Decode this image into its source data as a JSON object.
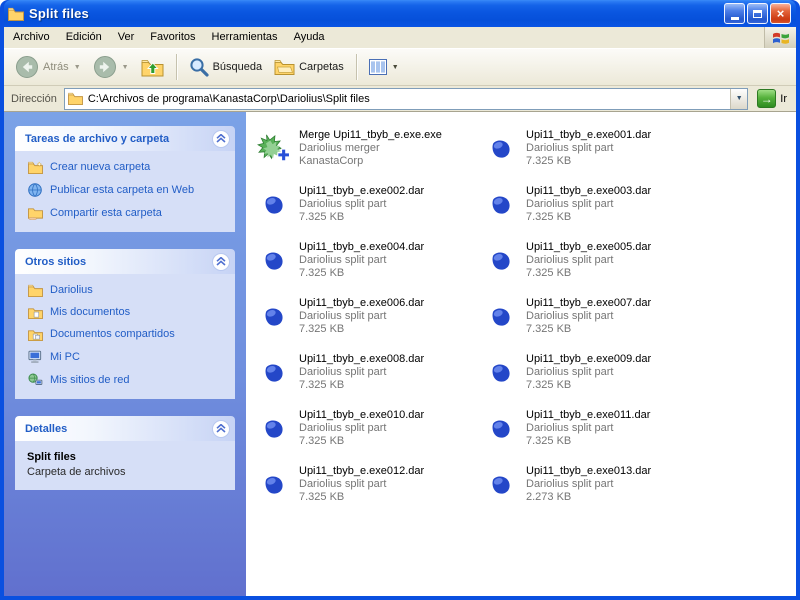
{
  "window": {
    "title": "Split files"
  },
  "menu": {
    "items": [
      "Archivo",
      "Edición",
      "Ver",
      "Favoritos",
      "Herramientas",
      "Ayuda"
    ]
  },
  "toolbar": {
    "back": "Atrás",
    "search": "Búsqueda",
    "folders": "Carpetas"
  },
  "address": {
    "label": "Dirección",
    "path": "C:\\Archivos de programa\\KanastaCorp\\Dariolius\\Split files",
    "go": "Ir"
  },
  "sidebar": {
    "tasks": {
      "title": "Tareas de archivo y carpeta",
      "items": [
        {
          "label": "Crear nueva carpeta"
        },
        {
          "label": "Publicar esta carpeta en Web"
        },
        {
          "label": "Compartir esta carpeta"
        }
      ]
    },
    "places": {
      "title": "Otros sitios",
      "items": [
        {
          "label": "Dariolius"
        },
        {
          "label": "Mis documentos"
        },
        {
          "label": "Documentos compartidos"
        },
        {
          "label": "Mi PC"
        },
        {
          "label": "Mis sitios de red"
        }
      ]
    },
    "details": {
      "title": "Detalles",
      "name": "Split files",
      "type": "Carpeta de archivos"
    }
  },
  "files": [
    {
      "icon": "merger",
      "name": "Merge Upi11_tbyb_e.exe.exe",
      "desc": "Dariolius merger",
      "info": "KanastaCorp"
    },
    {
      "icon": "dar",
      "name": "Upi11_tbyb_e.exe001.dar",
      "desc": "Dariolius split part",
      "info": "7.325 KB"
    },
    {
      "icon": "dar",
      "name": "Upi11_tbyb_e.exe002.dar",
      "desc": "Dariolius split part",
      "info": "7.325 KB"
    },
    {
      "icon": "dar",
      "name": "Upi11_tbyb_e.exe003.dar",
      "desc": "Dariolius split part",
      "info": "7.325 KB"
    },
    {
      "icon": "dar",
      "name": "Upi11_tbyb_e.exe004.dar",
      "desc": "Dariolius split part",
      "info": "7.325 KB"
    },
    {
      "icon": "dar",
      "name": "Upi11_tbyb_e.exe005.dar",
      "desc": "Dariolius split part",
      "info": "7.325 KB"
    },
    {
      "icon": "dar",
      "name": "Upi11_tbyb_e.exe006.dar",
      "desc": "Dariolius split part",
      "info": "7.325 KB"
    },
    {
      "icon": "dar",
      "name": "Upi11_tbyb_e.exe007.dar",
      "desc": "Dariolius split part",
      "info": "7.325 KB"
    },
    {
      "icon": "dar",
      "name": "Upi11_tbyb_e.exe008.dar",
      "desc": "Dariolius split part",
      "info": "7.325 KB"
    },
    {
      "icon": "dar",
      "name": "Upi11_tbyb_e.exe009.dar",
      "desc": "Dariolius split part",
      "info": "7.325 KB"
    },
    {
      "icon": "dar",
      "name": "Upi11_tbyb_e.exe010.dar",
      "desc": "Dariolius split part",
      "info": "7.325 KB"
    },
    {
      "icon": "dar",
      "name": "Upi11_tbyb_e.exe011.dar",
      "desc": "Dariolius split part",
      "info": "7.325 KB"
    },
    {
      "icon": "dar",
      "name": "Upi11_tbyb_e.exe012.dar",
      "desc": "Dariolius split part",
      "info": "7.325 KB"
    },
    {
      "icon": "dar",
      "name": "Upi11_tbyb_e.exe013.dar",
      "desc": "Dariolius split part",
      "info": "2.273 KB"
    }
  ]
}
